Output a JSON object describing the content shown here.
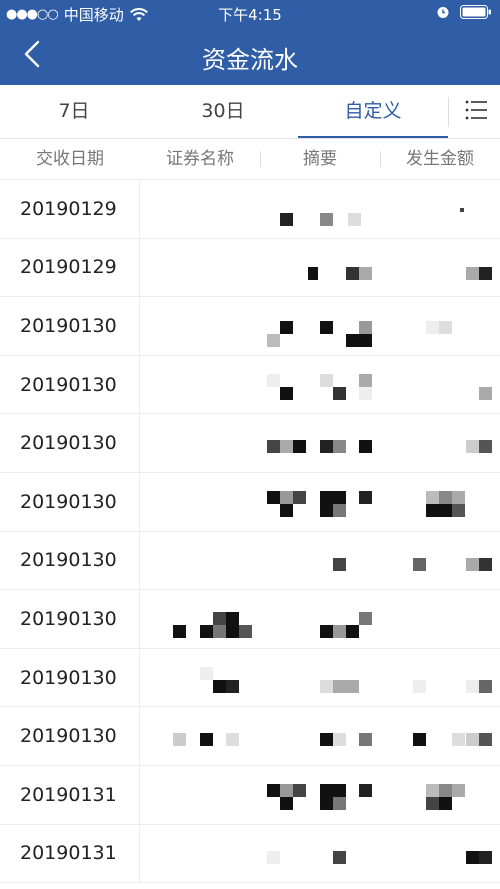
{
  "status_bar": {
    "signal": "●●●○○",
    "carrier": "中国移动",
    "time": "下午4:15",
    "icons": [
      "wifi-icon",
      "alarm-icon",
      "battery-icon"
    ]
  },
  "nav": {
    "title": "资金流水",
    "back_icon": "chevron-left-icon"
  },
  "tabs": [
    {
      "label": "7日",
      "active": false
    },
    {
      "label": "30日",
      "active": false
    },
    {
      "label": "自定义",
      "active": true
    }
  ],
  "menu_icon": "list-menu-icon",
  "columns": [
    "交收日期",
    "证券名称",
    "摘要",
    "发生金额"
  ],
  "rows": [
    {
      "date": "20190129"
    },
    {
      "date": "20190129"
    },
    {
      "date": "20190130"
    },
    {
      "date": "20190130"
    },
    {
      "date": "20190130"
    },
    {
      "date": "20190130"
    },
    {
      "date": "20190130"
    },
    {
      "date": "20190130"
    },
    {
      "date": "20190130"
    },
    {
      "date": "20190130"
    },
    {
      "date": "20190131"
    },
    {
      "date": "20190131"
    }
  ],
  "colors": {
    "header_bg": "#2f5da6",
    "accent": "#2f5da6",
    "text": "#222222",
    "muted": "#777777"
  }
}
